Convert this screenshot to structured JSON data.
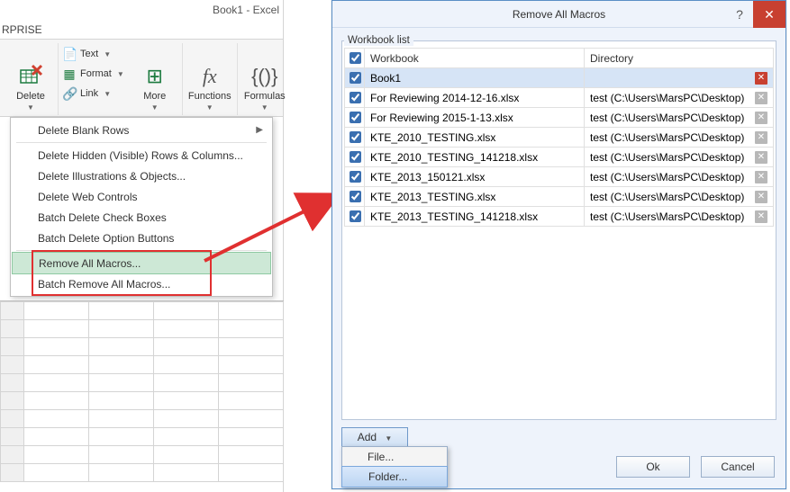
{
  "excel": {
    "title": "Book1 - Excel",
    "tab_fragment": "RPRISE",
    "ribbon": {
      "delete_label": "Delete",
      "text_label": "Text",
      "format_label": "Format",
      "link_label": "Link",
      "more_label": "More",
      "functions_label": "Functions",
      "formulas_label": "Formulas"
    },
    "menu": [
      {
        "label": "Delete Blank Rows",
        "has_sub": true
      },
      {
        "label": "Delete Hidden (Visible) Rows & Columns..."
      },
      {
        "label": "Delete Illustrations & Objects..."
      },
      {
        "label": "Delete Web Controls"
      },
      {
        "label": "Batch Delete Check Boxes"
      },
      {
        "label": "Batch Delete Option Buttons"
      },
      {
        "label": "Remove All Macros...",
        "hover": true
      },
      {
        "label": "Batch Remove All Macros..."
      }
    ]
  },
  "dialog": {
    "title": "Remove All Macros",
    "workbook_list_label": "Workbook list",
    "col_workbook": "Workbook",
    "col_directory": "Directory",
    "rows": [
      {
        "name": "Book1",
        "dir": "",
        "sel": true,
        "red": true
      },
      {
        "name": "For Reviewing 2014-12-16.xlsx",
        "dir": "test (C:\\Users\\MarsPC\\Desktop)"
      },
      {
        "name": "For Reviewing 2015-1-13.xlsx",
        "dir": "test (C:\\Users\\MarsPC\\Desktop)"
      },
      {
        "name": "KTE_2010_TESTING.xlsx",
        "dir": "test (C:\\Users\\MarsPC\\Desktop)"
      },
      {
        "name": "KTE_2010_TESTING_141218.xlsx",
        "dir": "test (C:\\Users\\MarsPC\\Desktop)"
      },
      {
        "name": "KTE_2013_150121.xlsx",
        "dir": "test (C:\\Users\\MarsPC\\Desktop)"
      },
      {
        "name": "KTE_2013_TESTING.xlsx",
        "dir": "test (C:\\Users\\MarsPC\\Desktop)"
      },
      {
        "name": "KTE_2013_TESTING_141218.xlsx",
        "dir": "test (C:\\Users\\MarsPC\\Desktop)"
      }
    ],
    "add_label": "Add",
    "add_menu": {
      "file": "File...",
      "folder": "Folder..."
    },
    "ok_label": "Ok",
    "cancel_label": "Cancel"
  }
}
